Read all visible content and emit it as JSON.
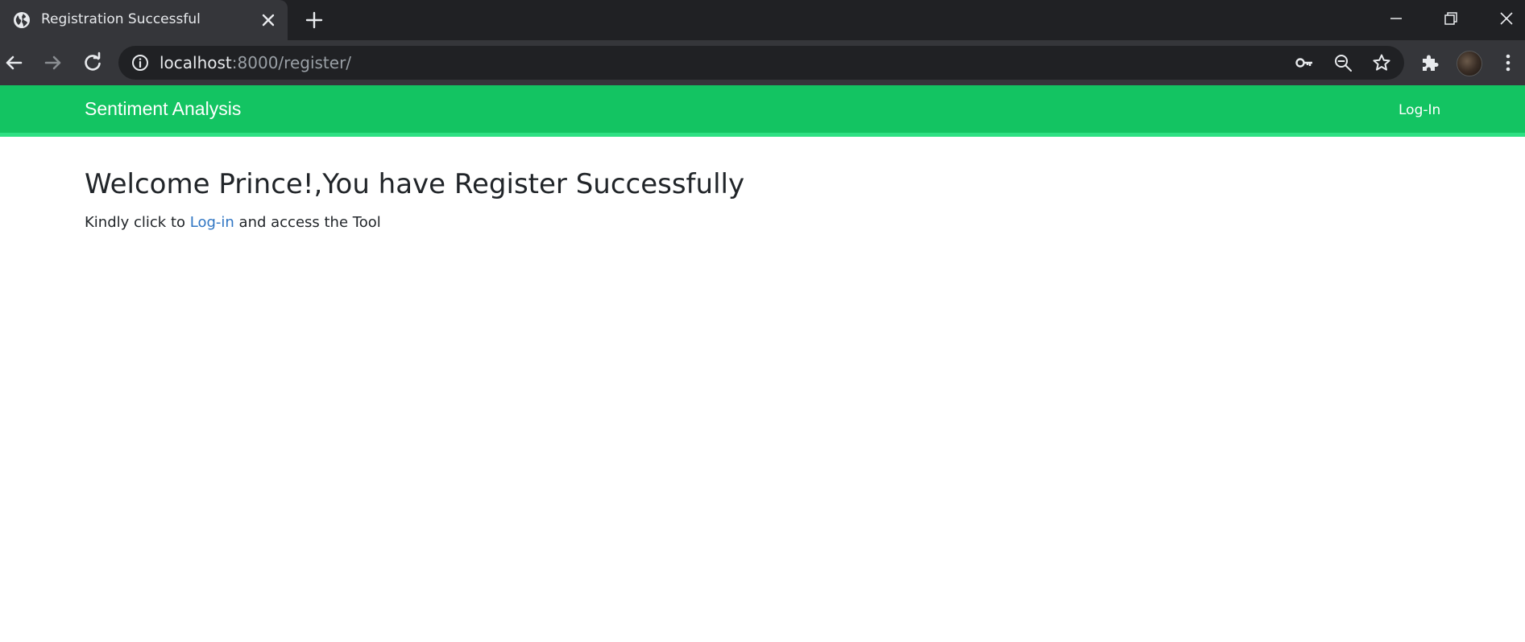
{
  "browser": {
    "tab": {
      "title": "Registration Successful"
    },
    "address": {
      "host": "localhost",
      "rest": ":8000/register/"
    },
    "icons": {
      "favicon": "globe-icon",
      "close": "close-icon",
      "new_tab": "plus-icon",
      "back": "arrow-left-icon",
      "forward": "arrow-right-icon",
      "reload": "reload-icon",
      "info": "info-icon",
      "key": "key-icon",
      "zoom": "zoom-out-icon",
      "star": "star-icon",
      "extensions": "puzzle-icon",
      "menu": "kebab-menu-icon"
    }
  },
  "navbar": {
    "brand": "Sentiment Analysis",
    "login": "Log-In",
    "color": "#13c462"
  },
  "main": {
    "heading": "Welcome Prince!,You have Register Successfully",
    "prefix": "Kindly click to ",
    "link": "Log-in",
    "suffix": " and access the Tool",
    "link_color": "#2f75c3"
  }
}
